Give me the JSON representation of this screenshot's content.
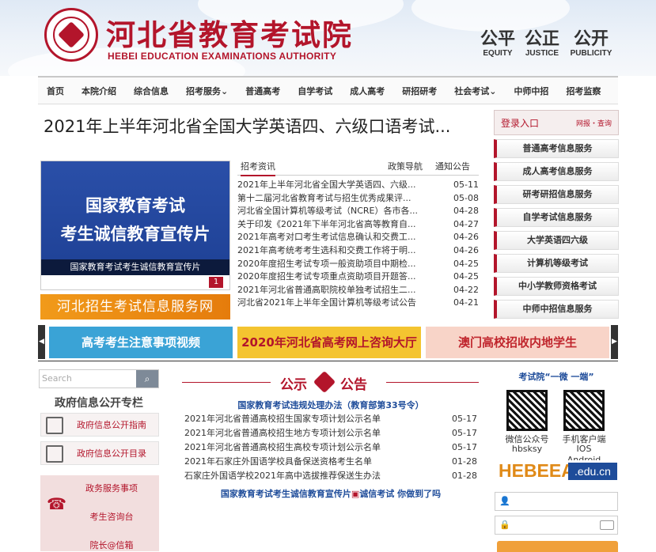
{
  "header": {
    "title": "河北省教育考试院",
    "subtitle": "HEBEI EDUCATION EXAMINATIONS AUTHORITY",
    "mottos": [
      {
        "cn": "公平",
        "en": "EQUITY"
      },
      {
        "cn": "公正",
        "en": "JUSTICE"
      },
      {
        "cn": "公开",
        "en": "PUBLICITY"
      }
    ]
  },
  "nav": {
    "items": [
      "首页",
      "本院介绍",
      "综合信息",
      "招考服务⌄",
      "普通高考",
      "自学考试",
      "成人高考",
      "研招研考",
      "社会考试⌄",
      "中师中招",
      "招考监察"
    ]
  },
  "headline": "2021年上半年河北省全国大学英语四、六级口语考试...",
  "banner": {
    "line1": "国家教育考试",
    "line2": "考生诚信教育宣传片",
    "caption": "国家教育考试考生诚信教育宣传片",
    "page": "1"
  },
  "hebei_link": "河北招生考试信息服务网",
  "tabs": {
    "t1": "招考资讯",
    "t2": "政策导航",
    "t3": "通知公告"
  },
  "news": [
    {
      "title": "2021年上半年河北省全国大学英语四、六级...",
      "date": "05-11"
    },
    {
      "title": "第十二届河北省教育考试与招生优秀成果评...",
      "date": "05-08"
    },
    {
      "title": "河北省全国计算机等级考试（NCRE）各市各...",
      "date": "04-28"
    },
    {
      "title": "关于印发《2021年下半年河北省高等教育自...",
      "date": "04-27"
    },
    {
      "title": "2021年高考对口考生考试信息确认和交费工...",
      "date": "04-26"
    },
    {
      "title": "2021年高考统考考生选科和交费工作将于明...",
      "date": "04-26"
    },
    {
      "title": "2020年度招生考试专项一般资助项目中期检...",
      "date": "04-25"
    },
    {
      "title": "2020年度招生考试专项重点资助项目开题答...",
      "date": "04-25"
    },
    {
      "title": "2021年河北省普通高职院校单独考试招生二...",
      "date": "04-22"
    },
    {
      "title": "河北省2021年上半年全国计算机等级考试公告",
      "date": "04-21"
    }
  ],
  "login": {
    "label": "登录入口",
    "links": "网报・查询"
  },
  "services": [
    "普通高考信息服务",
    "成人高考信息服务",
    "研考研招信息服务",
    "自学考试信息服务",
    "大学英语四六级",
    "计算机等级考试",
    "中小学教师资格考试",
    "中师中招信息服务"
  ],
  "banners": {
    "b1": "高考考生注意事项视频",
    "b2": "2020年河北省高考网上咨询大厅",
    "b3": "澳门高校招收内地学生"
  },
  "search": {
    "placeholder": "Search"
  },
  "gov": {
    "title": "政府信息公开专栏",
    "guide": "政府信息公开指南",
    "catalog": "政府信息公开目录"
  },
  "affairs": {
    "a1": "政务服务事项",
    "a2": "考生咨询台",
    "a3": "院长@信箱"
  },
  "notice": {
    "title_left": "公示",
    "title_right": "公告",
    "headline": "国家教育考试违规处理办法（教育部第33号令）",
    "rows": [
      {
        "title": "2021年河北省普通高校招生国家专项计划公示名单",
        "date": "05-17"
      },
      {
        "title": "2021年河北省普通高校招生地方专项计划公示名单",
        "date": "05-17"
      },
      {
        "title": "2021年河北省普通高校招生高校专项计划公示名单",
        "date": "05-17"
      },
      {
        "title": "2021年石家庄外国语学校具备保送资格考生名单",
        "date": "01-28"
      },
      {
        "title": "石家庄外国语学校2021年高中选拔推荐保送生办法",
        "date": "01-28"
      }
    ],
    "footer": "国家教育考试考生诚信教育宣传片",
    "footer2": "诚信考试 你做到了吗"
  },
  "media": {
    "caption": "考试院“一微 一端”",
    "wechat": "微信公众号",
    "wechat_id": "hbsksy",
    "app": "手机客户端",
    "app_os": "IOS",
    "app_android": "Android"
  },
  "hebeea": {
    "left": "HEBEEA",
    "right": ".edu.cn"
  },
  "colors": {
    "brand": "#b3152b",
    "link": "#1e4c9a",
    "orange": "#e57c0c"
  }
}
